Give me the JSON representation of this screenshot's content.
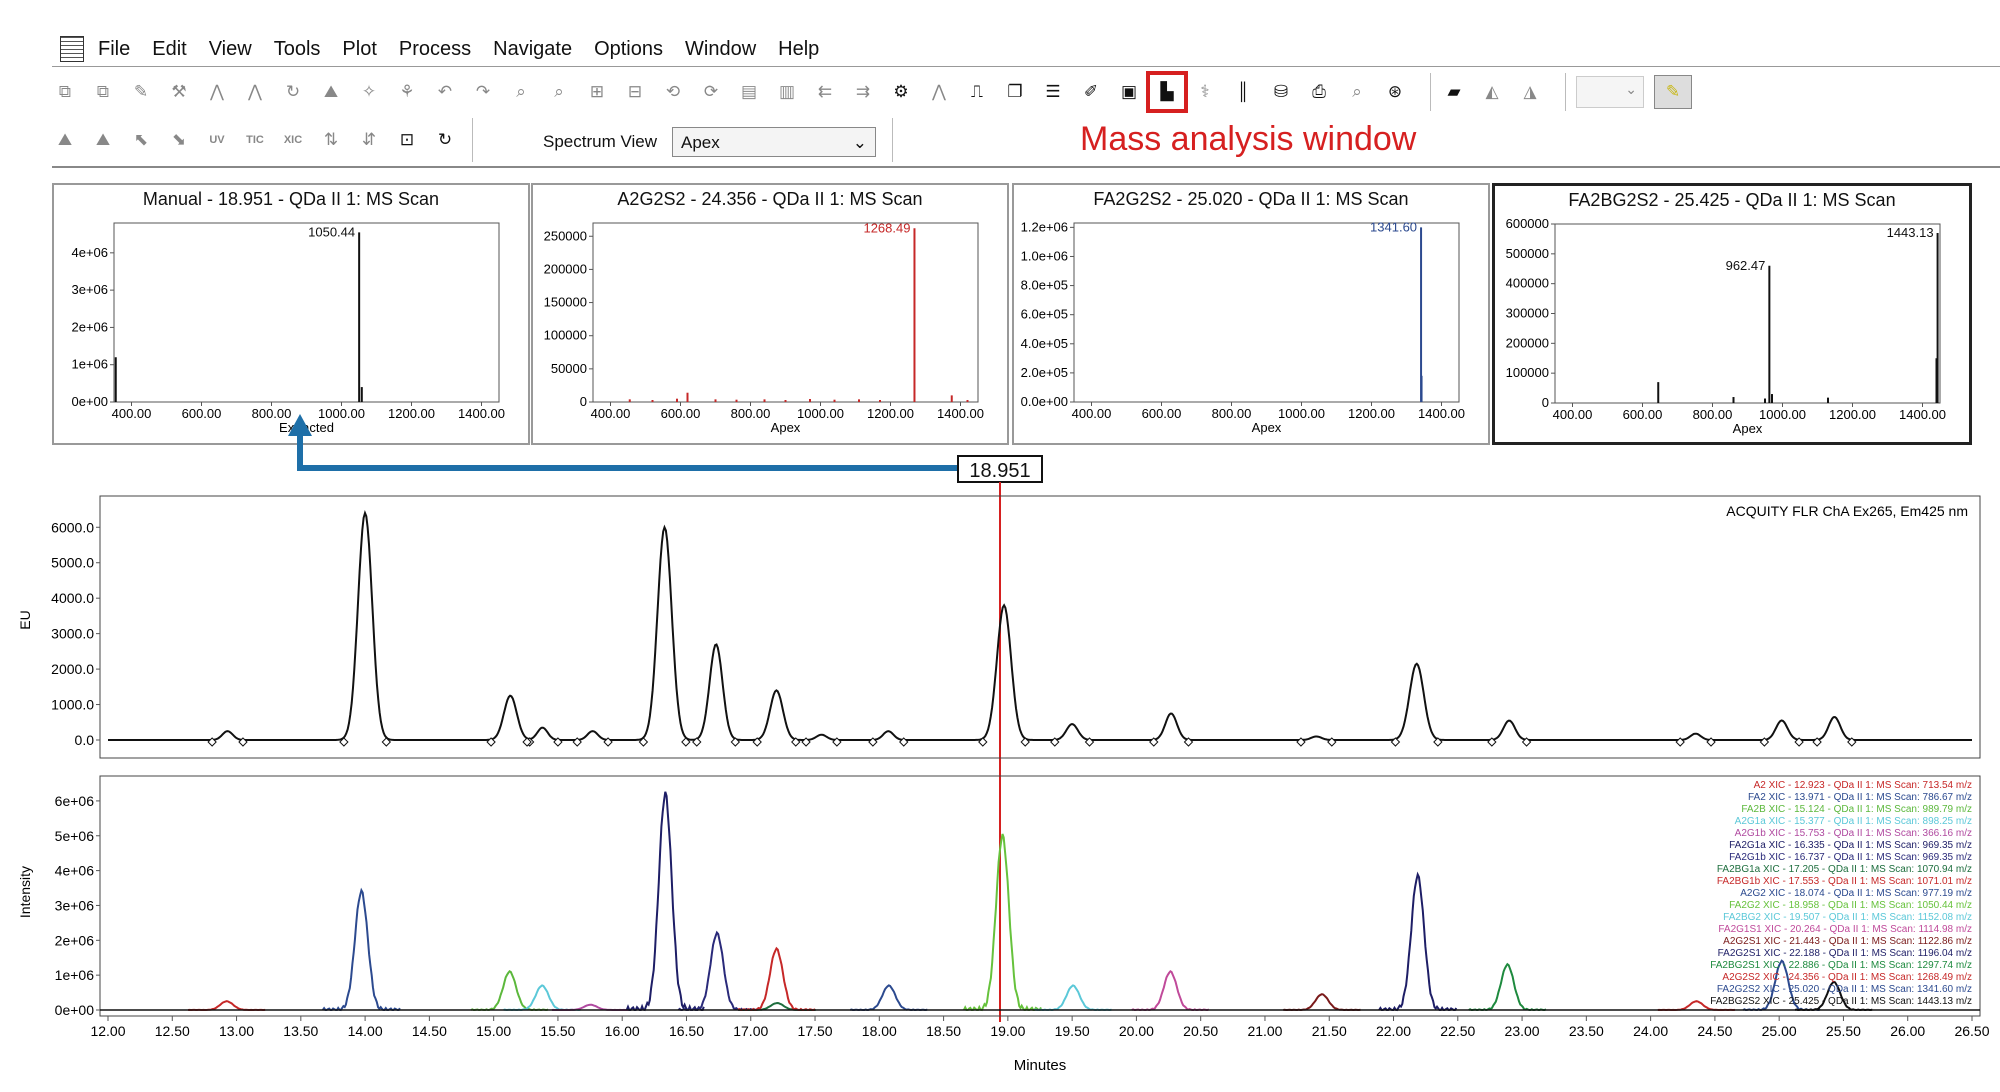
{
  "menu": [
    "File",
    "Edit",
    "View",
    "Tools",
    "Plot",
    "Process",
    "Navigate",
    "Options",
    "Window",
    "Help"
  ],
  "toolbar": {
    "spectrum_view_label": "Spectrum View",
    "spectrum_view_value": "Apex",
    "toolbar2_labels": [
      "UV",
      "TIC",
      "XIC"
    ]
  },
  "annotation": {
    "label": "Mass analysis window",
    "color": "#d62020"
  },
  "spectra": [
    {
      "title": "Manual - 18.951 - QDa II 1: MS Scan",
      "xlabel": "Extracted",
      "yticks": [
        "0e+00",
        "1e+06",
        "2e+06",
        "3e+06",
        "4e+06"
      ],
      "ymax": 4800000,
      "xticks": [
        "400.00",
        "600.00",
        "800.00",
        "1000.00",
        "1200.00",
        "1400.00"
      ],
      "xlim": [
        350,
        1450
      ],
      "color": "#111111",
      "peak_labels": [
        {
          "mz": 1050.44,
          "label": "1050.44",
          "intensity": 4550000
        }
      ],
      "peaks": [
        [
          355,
          1200000
        ],
        [
          1050.44,
          4550000
        ],
        [
          1058,
          400000
        ]
      ],
      "active": false
    },
    {
      "title": "A2G2S2 - 24.356 - QDa II 1: MS Scan",
      "xlabel": "Apex",
      "yticks": [
        "0",
        "50000",
        "100000",
        "150000",
        "200000",
        "250000"
      ],
      "ymax": 270000,
      "xticks": [
        "400.00",
        "600.00",
        "800.00",
        "1000.00",
        "1200.00",
        "1400.00"
      ],
      "xlim": [
        350,
        1450
      ],
      "color": "#c62828",
      "peak_labels": [
        {
          "mz": 1268.49,
          "label": "1268.49",
          "intensity": 262000
        }
      ],
      "peaks": [
        [
          455,
          4000
        ],
        [
          520,
          3000
        ],
        [
          590,
          5000
        ],
        [
          620,
          14000
        ],
        [
          700,
          4000
        ],
        [
          760,
          3500
        ],
        [
          840,
          4000
        ],
        [
          900,
          3000
        ],
        [
          970,
          4500
        ],
        [
          1040,
          3500
        ],
        [
          1110,
          4000
        ],
        [
          1170,
          3000
        ],
        [
          1268.49,
          262000
        ],
        [
          1375,
          10000
        ],
        [
          1420,
          3000
        ]
      ],
      "active": false
    },
    {
      "title": "FA2G2S2 - 25.020 - QDa II 1: MS Scan",
      "xlabel": "Apex",
      "yticks": [
        "0.0e+00",
        "2.0e+05",
        "4.0e+05",
        "6.0e+05",
        "8.0e+05",
        "1.0e+06",
        "1.2e+06"
      ],
      "ymax": 1230000,
      "xticks": [
        "400.00",
        "600.00",
        "800.00",
        "1000.00",
        "1200.00",
        "1400.00"
      ],
      "xlim": [
        350,
        1450
      ],
      "color": "#2c4a8f",
      "peak_labels": [
        {
          "mz": 1341.6,
          "label": "1341.60",
          "intensity": 1200000
        }
      ],
      "peaks": [
        [
          1341.6,
          1200000
        ],
        [
          1343,
          180000
        ]
      ],
      "active": false
    },
    {
      "title": "FA2BG2S2 - 25.425 - QDa II 1: MS Scan",
      "xlabel": "Apex",
      "yticks": [
        "0",
        "100000",
        "200000",
        "300000",
        "400000",
        "500000",
        "600000"
      ],
      "ymax": 600000,
      "xticks": [
        "400.00",
        "600.00",
        "800.00",
        "1000.00",
        "1200.00",
        "1400.00"
      ],
      "xlim": [
        350,
        1450
      ],
      "color": "#111111",
      "peak_labels": [
        {
          "mz": 962.47,
          "label": "962.47",
          "intensity": 460000
        },
        {
          "mz": 1443.13,
          "label": "1443.13",
          "intensity": 570000
        }
      ],
      "peaks": [
        [
          645,
          70000
        ],
        [
          860,
          20000
        ],
        [
          950,
          15000
        ],
        [
          962.47,
          460000
        ],
        [
          970,
          30000
        ],
        [
          1130,
          18000
        ],
        [
          1443.13,
          570000
        ],
        [
          1440,
          150000
        ]
      ],
      "active": true
    }
  ],
  "retention_marker": "18.951",
  "chromatogram": {
    "title": "ACQUITY FLR ChA Ex265, Em425 nm",
    "ylabel": "EU",
    "yticks": [
      "0.0",
      "1000.0",
      "2000.0",
      "3000.0",
      "4000.0",
      "5000.0",
      "6000.0"
    ],
    "ymax": 6600,
    "xlim": [
      12.0,
      26.5
    ],
    "peaks": [
      [
        12.93,
        250,
        0.04
      ],
      [
        14.0,
        6400,
        0.055
      ],
      [
        15.13,
        1250,
        0.05
      ],
      [
        15.38,
        350,
        0.04
      ],
      [
        15.77,
        250,
        0.04
      ],
      [
        16.33,
        6000,
        0.055
      ],
      [
        16.73,
        2700,
        0.05
      ],
      [
        17.2,
        1400,
        0.05
      ],
      [
        17.55,
        150,
        0.04
      ],
      [
        18.07,
        250,
        0.04
      ],
      [
        18.97,
        3800,
        0.055
      ],
      [
        19.5,
        450,
        0.045
      ],
      [
        20.27,
        750,
        0.045
      ],
      [
        21.4,
        100,
        0.04
      ],
      [
        22.18,
        2150,
        0.055
      ],
      [
        22.9,
        550,
        0.045
      ],
      [
        24.35,
        180,
        0.04
      ],
      [
        25.02,
        550,
        0.045
      ],
      [
        25.43,
        650,
        0.045
      ]
    ]
  },
  "xic": {
    "ylabel": "Intensity",
    "xlabel": "Minutes",
    "yticks": [
      "0e+00",
      "1e+06",
      "2e+06",
      "3e+06",
      "4e+06",
      "5e+06",
      "6e+06"
    ],
    "ymax": 6600000,
    "xticks": [
      "12.00",
      "12.50",
      "13.00",
      "13.50",
      "14.00",
      "14.50",
      "15.00",
      "15.50",
      "16.00",
      "16.50",
      "17.00",
      "17.50",
      "18.00",
      "18.50",
      "19.00",
      "19.50",
      "20.00",
      "20.50",
      "21.00",
      "21.50",
      "22.00",
      "22.50",
      "23.00",
      "23.50",
      "24.00",
      "24.50",
      "25.00",
      "25.50",
      "26.00",
      "26.50"
    ],
    "xlim": [
      12.0,
      26.5
    ],
    "legend": [
      {
        "text": "A2 XIC - 12.923 - QDa II 1: MS Scan: 713.54 m/z",
        "color": "#c62828",
        "rt": 12.923,
        "height": 250000
      },
      {
        "text": "FA2 XIC - 13.971 - QDa II 1: MS Scan: 786.67 m/z",
        "color": "#2c4a8f",
        "rt": 13.971,
        "height": 3400000
      },
      {
        "text": "FA2B XIC - 15.124 - QDa II 1: MS Scan: 989.79 m/z",
        "color": "#5cb83c",
        "rt": 15.124,
        "height": 1100000
      },
      {
        "text": "A2G1a XIC - 15.377 - QDa II 1: MS Scan: 898.25 m/z",
        "color": "#5bc8d8",
        "rt": 15.377,
        "height": 700000
      },
      {
        "text": "A2G1b XIC - 15.753 - QDa II 1: MS Scan: 366.16 m/z",
        "color": "#b04aa0",
        "rt": 15.753,
        "height": 150000
      },
      {
        "text": "FA2G1a XIC - 16.335 - QDa II 1: MS Scan: 969.35 m/z",
        "color": "#1e1e66",
        "rt": 16.335,
        "height": 6200000
      },
      {
        "text": "FA2G1b XIC - 16.737 - QDa II 1: MS Scan: 969.35 m/z",
        "color": "#2a2a7a",
        "rt": 16.737,
        "height": 2200000
      },
      {
        "text": "FA2BG1a XIC - 17.205 - QDa II 1: MS Scan: 1070.94 m/z",
        "color": "#1e6e3e",
        "rt": 17.205,
        "height": 200000
      },
      {
        "text": "FA2BG1b XIC - 17.553 - QDa II 1: MS Scan: 1071.01 m/z",
        "color": "#c62828",
        "rt": 17.2,
        "height": 1750000
      },
      {
        "text": "A2G2 XIC - 18.074 - QDa II 1: MS Scan: 977.19 m/z",
        "color": "#2c4a8f",
        "rt": 18.074,
        "height": 700000
      },
      {
        "text": "FA2G2 XIC - 18.958 - QDa II 1: MS Scan: 1050.44 m/z",
        "color": "#66c23c",
        "rt": 18.958,
        "height": 5000000
      },
      {
        "text": "FA2BG2 XIC - 19.507 - QDa II 1: MS Scan: 1152.08 m/z",
        "color": "#5bc8d8",
        "rt": 19.507,
        "height": 700000
      },
      {
        "text": "FA2G1S1 XIC - 20.264 - QDa II 1: MS Scan: 1114.98 m/z",
        "color": "#c04a9a",
        "rt": 20.264,
        "height": 1100000
      },
      {
        "text": "A2G2S1 XIC - 21.443 - QDa II 1: MS Scan: 1122.86 m/z",
        "color": "#7a1a1a",
        "rt": 21.443,
        "height": 450000
      },
      {
        "text": "FA2G2S1 XIC - 22.188 - QDa II 1: MS Scan: 1196.04 m/z",
        "color": "#1e1e66",
        "rt": 22.188,
        "height": 3850000
      },
      {
        "text": "FA2BG2S1 XIC - 22.886 - QDa II 1: MS Scan: 1297.74 m/z",
        "color": "#1e8a3e",
        "rt": 22.886,
        "height": 1300000
      },
      {
        "text": "A2G2S2 XIC - 24.356 - QDa II 1: MS Scan: 1268.49 m/z",
        "color": "#c62828",
        "rt": 24.356,
        "height": 250000
      },
      {
        "text": "FA2G2S2 XIC - 25.020 - QDa II 1: MS Scan: 1341.60 m/z",
        "color": "#2c4a8f",
        "rt": 25.02,
        "height": 1400000
      },
      {
        "text": "FA2BG2S2 XIC - 25.425 - QDa II 1: MS Scan: 1443.13 m/z",
        "color": "#111111",
        "rt": 25.425,
        "height": 800000
      }
    ]
  }
}
